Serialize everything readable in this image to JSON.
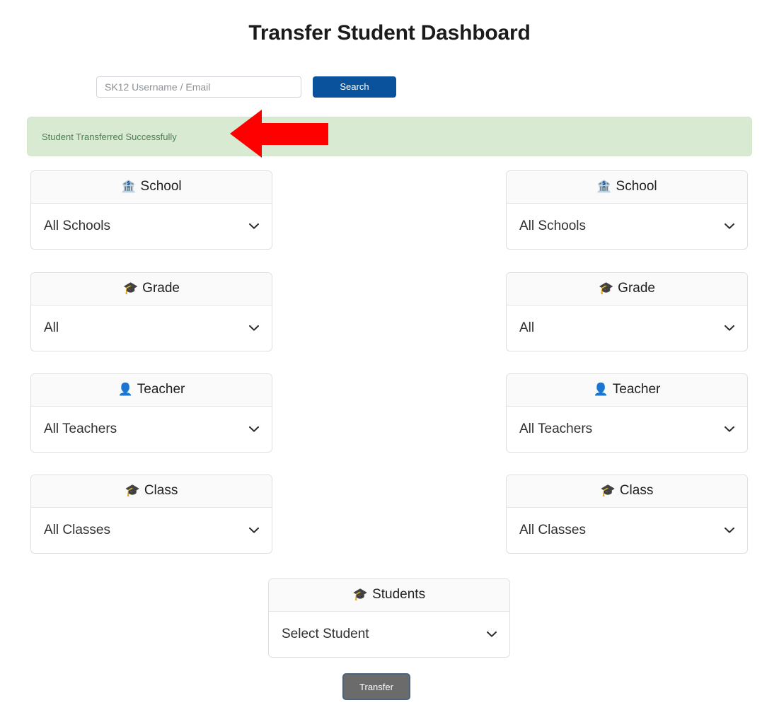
{
  "page": {
    "title": "Transfer Student Dashboard"
  },
  "search": {
    "placeholder": "SK12 Username / Email",
    "value": "",
    "button_label": "Search",
    "button_color": "#0a539c"
  },
  "alert": {
    "message": "Student Transferred Successfully",
    "background_color": "#d9ead3",
    "text_color": "#4a7f52"
  },
  "annotation": {
    "type": "arrow",
    "direction": "left",
    "color": "#ff0000"
  },
  "source_panel": {
    "cards": [
      {
        "header": "School",
        "icon": "bank-icon",
        "icon_glyph": "🏦",
        "value": "All Schools"
      },
      {
        "header": "Grade",
        "icon": "graduation-cap-icon",
        "icon_glyph": "🎓",
        "value": "All"
      },
      {
        "header": "Teacher",
        "icon": "user-icon",
        "icon_glyph": "👤",
        "value": "All Teachers"
      },
      {
        "header": "Class",
        "icon": "graduation-cap-icon",
        "icon_glyph": "🎓",
        "value": "All Classes"
      }
    ]
  },
  "destination_panel": {
    "cards": [
      {
        "header": "School",
        "icon": "bank-icon",
        "icon_glyph": "🏦",
        "value": "All Schools"
      },
      {
        "header": "Grade",
        "icon": "graduation-cap-icon",
        "icon_glyph": "🎓",
        "value": "All"
      },
      {
        "header": "Teacher",
        "icon": "user-icon",
        "icon_glyph": "👤",
        "value": "All Teachers"
      },
      {
        "header": "Class",
        "icon": "graduation-cap-icon",
        "icon_glyph": "🎓",
        "value": "All Classes"
      }
    ]
  },
  "students_card": {
    "header": "Students",
    "icon": "graduation-cap-icon",
    "icon_glyph": "🎓",
    "value": "Select Student"
  },
  "transfer": {
    "label": "Transfer",
    "background_color": "#6b6b6b",
    "border_color": "#4a637d"
  }
}
